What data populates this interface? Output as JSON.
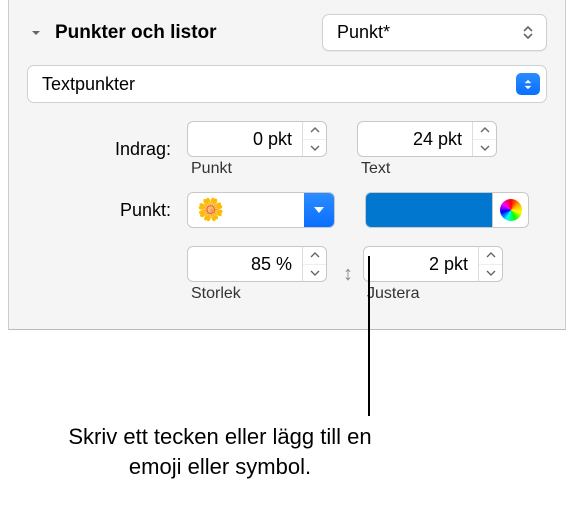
{
  "header": {
    "title": "Punkter och listor",
    "style_popup": "Punkt*"
  },
  "type_popup": "Textpunkter",
  "indent": {
    "label": "Indrag:",
    "bullet_value": "0 pkt",
    "bullet_sublabel": "Punkt",
    "text_value": "24 pkt",
    "text_sublabel": "Text"
  },
  "bullet": {
    "label": "Punkt:",
    "symbol": "🌼",
    "color": "#0277d0"
  },
  "size": {
    "value": "85 %",
    "label": "Storlek"
  },
  "align": {
    "value": "2 pkt",
    "label": "Justera"
  },
  "callout": "Skriv ett tecken eller lägg till en emoji eller symbol."
}
